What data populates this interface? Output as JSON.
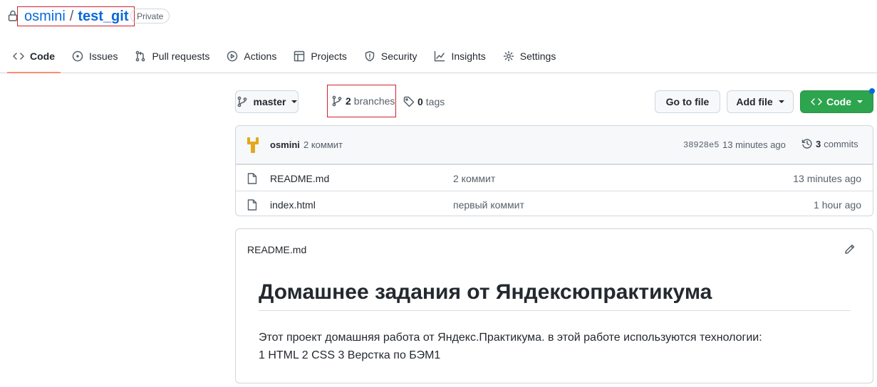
{
  "repo": {
    "owner": "osmini",
    "separator": "/",
    "name": "test_git",
    "visibility": "Private"
  },
  "tabs": [
    {
      "label": "Code",
      "icon": "code-icon",
      "active": true
    },
    {
      "label": "Issues",
      "icon": "issue-icon"
    },
    {
      "label": "Pull requests",
      "icon": "pull-request-icon"
    },
    {
      "label": "Actions",
      "icon": "play-icon"
    },
    {
      "label": "Projects",
      "icon": "table-icon"
    },
    {
      "label": "Security",
      "icon": "shield-icon"
    },
    {
      "label": "Insights",
      "icon": "graph-icon"
    },
    {
      "label": "Settings",
      "icon": "gear-icon"
    }
  ],
  "toolbar": {
    "branch": "master",
    "branches_count": "2",
    "branches_label": "branches",
    "tags_count": "0",
    "tags_label": "tags",
    "go_to_file": "Go to file",
    "add_file": "Add file",
    "code": "Code"
  },
  "latest_commit": {
    "author": "osmini",
    "message": "2 коммит",
    "sha": "38928e5",
    "time": "13 minutes ago",
    "commits_count": "3",
    "commits_label": "commits"
  },
  "files": [
    {
      "name": "README.md",
      "message": "2 коммит",
      "time": "13 minutes ago"
    },
    {
      "name": "index.html",
      "message": "первый коммит",
      "time": "1 hour ago"
    }
  ],
  "readme": {
    "filename": "README.md",
    "heading": "Домашнее задания от Яндексюпрактикума",
    "line1": "Этот проект домашняя работа от Яндекс.Практикума. в этой работе используются технологии:",
    "line2": "1 HTML 2 CSS 3 Верстка по БЭМ1"
  },
  "colors": {
    "accent_blue": "#0969da",
    "code_green": "#2da44e",
    "highlight_red": "#cf222e",
    "active_tab_underline": "#fd8c73"
  }
}
